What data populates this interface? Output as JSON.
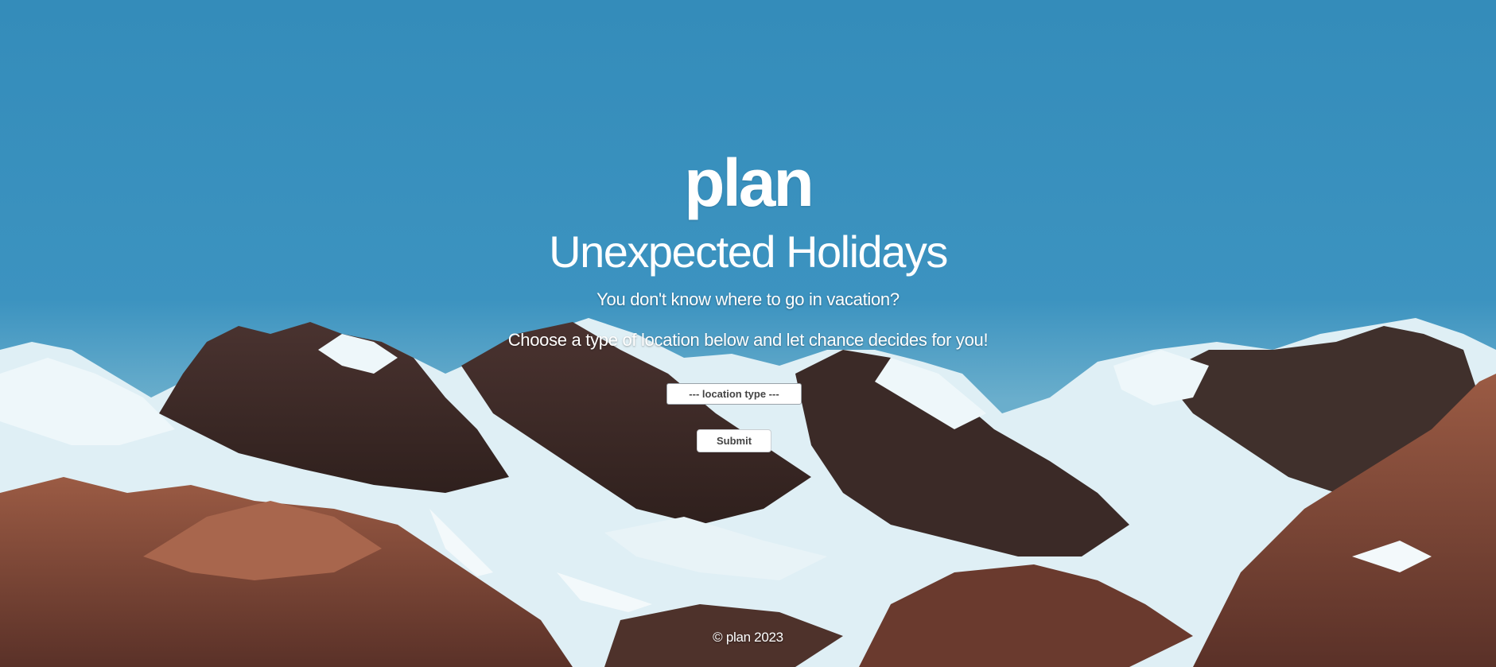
{
  "brand": {
    "logo": "plan"
  },
  "hero": {
    "title": "Unexpected Holidays",
    "line1": "You don't know where to go in vacation?",
    "line2": "Choose a type of location below and let chance decides for you!"
  },
  "form": {
    "location_select": "--- location type ---",
    "submit_label": "Submit"
  },
  "footer": {
    "copyright": "© plan 2023"
  },
  "colors": {
    "sky": "#358dbb",
    "snow": "#e6f2f6",
    "rock_dark": "#3a2a26",
    "rock_brown": "#8a4f3c",
    "text": "#ffffff"
  }
}
